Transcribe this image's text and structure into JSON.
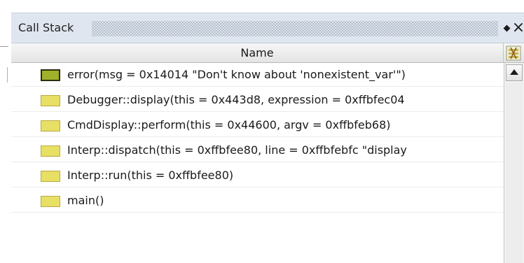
{
  "panel": {
    "title": "Call Stack",
    "close_symbol": "×",
    "pin_icon": "pin-icon",
    "close_icon": "close-icon"
  },
  "table": {
    "column_header": "Name",
    "column_config_icon": "column-config-icon",
    "rows": [
      {
        "label": "error(msg = 0x14014 \"Don't know about 'nonexistent_var'\")",
        "icon": "stack-frame-icon",
        "current": true
      },
      {
        "label": "Debugger::display(this = 0x443d8, expression = 0xffbfec04",
        "icon": "stack-frame-icon",
        "current": false
      },
      {
        "label": "CmdDisplay::perform(this = 0x44600, argv = 0xffbfeb68)",
        "icon": "stack-frame-icon",
        "current": false
      },
      {
        "label": "Interp::dispatch(this = 0xffbfee80, line = 0xffbfebfc \"display",
        "icon": "stack-frame-icon",
        "current": false
      },
      {
        "label": "Interp::run(this = 0xffbfee80)",
        "icon": "stack-frame-icon",
        "current": false
      },
      {
        "label": "main()",
        "icon": "stack-frame-icon",
        "current": false
      }
    ]
  },
  "scrollbar": {
    "up_icon": "scroll-up-icon"
  },
  "colors": {
    "titlebar": "#dfe6ef",
    "frame_icon": "#e8df65",
    "current_frame_icon": "#9fb02a"
  }
}
